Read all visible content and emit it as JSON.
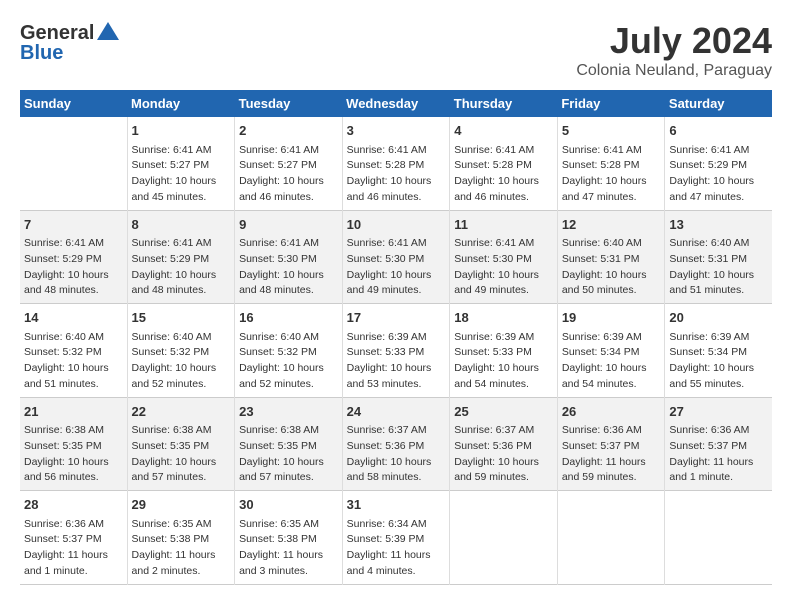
{
  "header": {
    "logo_general": "General",
    "logo_blue": "Blue",
    "month": "July 2024",
    "location": "Colonia Neuland, Paraguay"
  },
  "days_of_week": [
    "Sunday",
    "Monday",
    "Tuesday",
    "Wednesday",
    "Thursday",
    "Friday",
    "Saturday"
  ],
  "weeks": [
    {
      "cells": [
        {
          "day": "",
          "info": ""
        },
        {
          "day": "1",
          "info": "Sunrise: 6:41 AM\nSunset: 5:27 PM\nDaylight: 10 hours\nand 45 minutes."
        },
        {
          "day": "2",
          "info": "Sunrise: 6:41 AM\nSunset: 5:27 PM\nDaylight: 10 hours\nand 46 minutes."
        },
        {
          "day": "3",
          "info": "Sunrise: 6:41 AM\nSunset: 5:28 PM\nDaylight: 10 hours\nand 46 minutes."
        },
        {
          "day": "4",
          "info": "Sunrise: 6:41 AM\nSunset: 5:28 PM\nDaylight: 10 hours\nand 46 minutes."
        },
        {
          "day": "5",
          "info": "Sunrise: 6:41 AM\nSunset: 5:28 PM\nDaylight: 10 hours\nand 47 minutes."
        },
        {
          "day": "6",
          "info": "Sunrise: 6:41 AM\nSunset: 5:29 PM\nDaylight: 10 hours\nand 47 minutes."
        }
      ]
    },
    {
      "cells": [
        {
          "day": "7",
          "info": "Sunrise: 6:41 AM\nSunset: 5:29 PM\nDaylight: 10 hours\nand 48 minutes."
        },
        {
          "day": "8",
          "info": "Sunrise: 6:41 AM\nSunset: 5:29 PM\nDaylight: 10 hours\nand 48 minutes."
        },
        {
          "day": "9",
          "info": "Sunrise: 6:41 AM\nSunset: 5:30 PM\nDaylight: 10 hours\nand 48 minutes."
        },
        {
          "day": "10",
          "info": "Sunrise: 6:41 AM\nSunset: 5:30 PM\nDaylight: 10 hours\nand 49 minutes."
        },
        {
          "day": "11",
          "info": "Sunrise: 6:41 AM\nSunset: 5:30 PM\nDaylight: 10 hours\nand 49 minutes."
        },
        {
          "day": "12",
          "info": "Sunrise: 6:40 AM\nSunset: 5:31 PM\nDaylight: 10 hours\nand 50 minutes."
        },
        {
          "day": "13",
          "info": "Sunrise: 6:40 AM\nSunset: 5:31 PM\nDaylight: 10 hours\nand 51 minutes."
        }
      ]
    },
    {
      "cells": [
        {
          "day": "14",
          "info": "Sunrise: 6:40 AM\nSunset: 5:32 PM\nDaylight: 10 hours\nand 51 minutes."
        },
        {
          "day": "15",
          "info": "Sunrise: 6:40 AM\nSunset: 5:32 PM\nDaylight: 10 hours\nand 52 minutes."
        },
        {
          "day": "16",
          "info": "Sunrise: 6:40 AM\nSunset: 5:32 PM\nDaylight: 10 hours\nand 52 minutes."
        },
        {
          "day": "17",
          "info": "Sunrise: 6:39 AM\nSunset: 5:33 PM\nDaylight: 10 hours\nand 53 minutes."
        },
        {
          "day": "18",
          "info": "Sunrise: 6:39 AM\nSunset: 5:33 PM\nDaylight: 10 hours\nand 54 minutes."
        },
        {
          "day": "19",
          "info": "Sunrise: 6:39 AM\nSunset: 5:34 PM\nDaylight: 10 hours\nand 54 minutes."
        },
        {
          "day": "20",
          "info": "Sunrise: 6:39 AM\nSunset: 5:34 PM\nDaylight: 10 hours\nand 55 minutes."
        }
      ]
    },
    {
      "cells": [
        {
          "day": "21",
          "info": "Sunrise: 6:38 AM\nSunset: 5:35 PM\nDaylight: 10 hours\nand 56 minutes."
        },
        {
          "day": "22",
          "info": "Sunrise: 6:38 AM\nSunset: 5:35 PM\nDaylight: 10 hours\nand 57 minutes."
        },
        {
          "day": "23",
          "info": "Sunrise: 6:38 AM\nSunset: 5:35 PM\nDaylight: 10 hours\nand 57 minutes."
        },
        {
          "day": "24",
          "info": "Sunrise: 6:37 AM\nSunset: 5:36 PM\nDaylight: 10 hours\nand 58 minutes."
        },
        {
          "day": "25",
          "info": "Sunrise: 6:37 AM\nSunset: 5:36 PM\nDaylight: 10 hours\nand 59 minutes."
        },
        {
          "day": "26",
          "info": "Sunrise: 6:36 AM\nSunset: 5:37 PM\nDaylight: 11 hours\nand 59 minutes."
        },
        {
          "day": "27",
          "info": "Sunrise: 6:36 AM\nSunset: 5:37 PM\nDaylight: 11 hours\nand 1 minute."
        }
      ]
    },
    {
      "cells": [
        {
          "day": "28",
          "info": "Sunrise: 6:36 AM\nSunset: 5:37 PM\nDaylight: 11 hours\nand 1 minute."
        },
        {
          "day": "29",
          "info": "Sunrise: 6:35 AM\nSunset: 5:38 PM\nDaylight: 11 hours\nand 2 minutes."
        },
        {
          "day": "30",
          "info": "Sunrise: 6:35 AM\nSunset: 5:38 PM\nDaylight: 11 hours\nand 3 minutes."
        },
        {
          "day": "31",
          "info": "Sunrise: 6:34 AM\nSunset: 5:39 PM\nDaylight: 11 hours\nand 4 minutes."
        },
        {
          "day": "",
          "info": ""
        },
        {
          "day": "",
          "info": ""
        },
        {
          "day": "",
          "info": ""
        }
      ]
    }
  ]
}
